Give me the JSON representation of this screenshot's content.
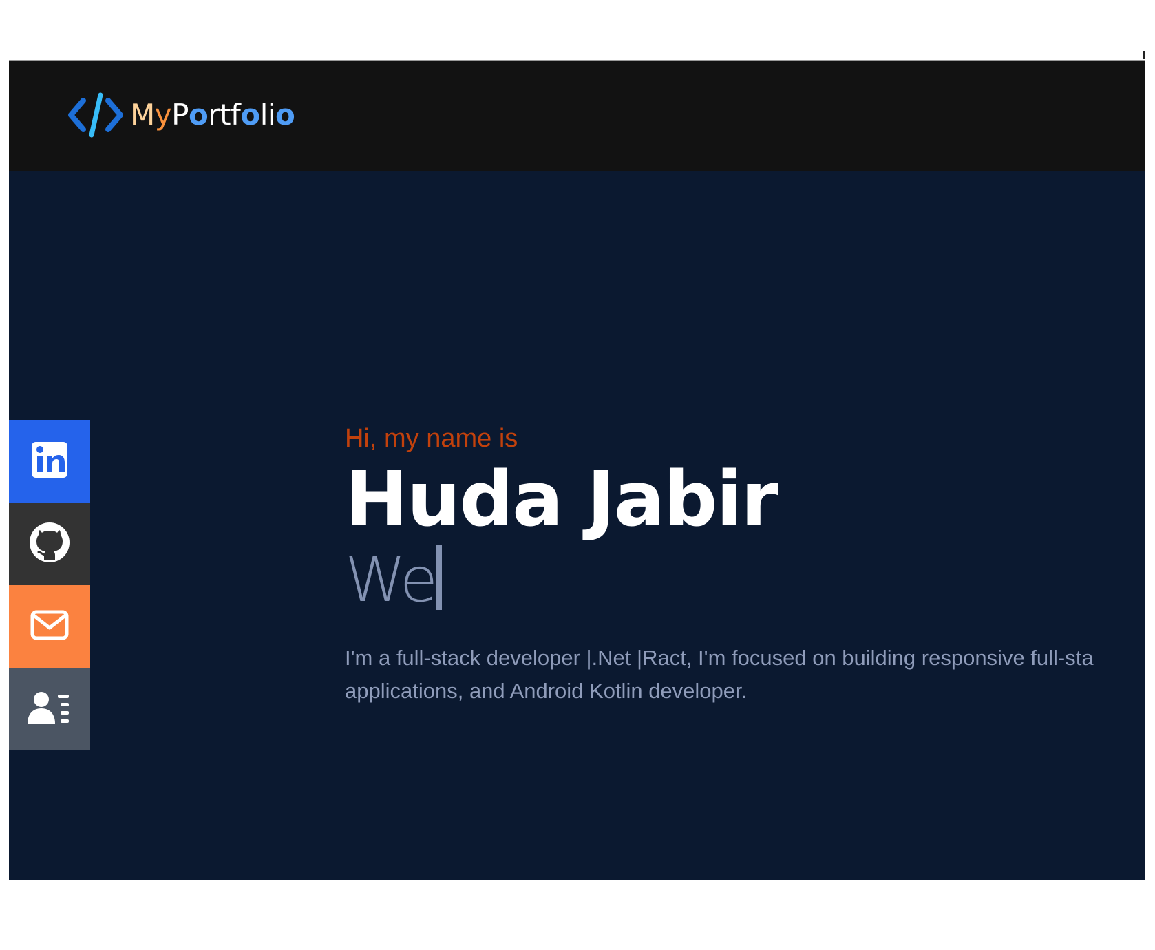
{
  "navbar": {
    "logo_icon": "code-brackets-icon",
    "logo_parts": [
      "M",
      "y",
      "P",
      "o",
      "r",
      "t",
      "f",
      "o",
      "l",
      "i",
      "o"
    ]
  },
  "social": [
    {
      "name": "linkedin",
      "icon": "linkedin-icon",
      "color": "#2563eb"
    },
    {
      "name": "github",
      "icon": "github-icon",
      "color": "#333333"
    },
    {
      "name": "email",
      "icon": "mail-icon",
      "color": "#fb8240"
    },
    {
      "name": "resume",
      "icon": "contact-card-icon",
      "color": "#4b5563"
    }
  ],
  "hero": {
    "greeting": "Hi, my name is",
    "name": "Huda Jabir",
    "typed_text": "We",
    "bio_line1": "I'm a full-stack developer |.Net |Ract, I'm focused on building responsive full-sta",
    "bio_line2": "applications, and Android Kotlin developer."
  },
  "colors": {
    "page_bg": "#0b1930",
    "navbar_bg": "#121212",
    "greeting": "#c2410c",
    "name": "#ffffff",
    "muted_text": "#8f9cba",
    "logo_accent": "#4f9cf5"
  }
}
